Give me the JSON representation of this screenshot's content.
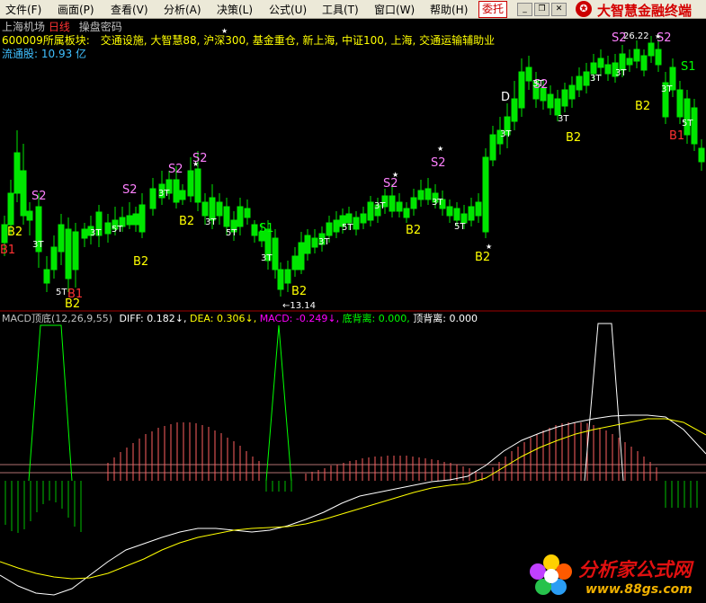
{
  "menu": {
    "items": [
      {
        "label": "文件(F)"
      },
      {
        "label": "画面(P)"
      },
      {
        "label": "查看(V)"
      },
      {
        "label": "分析(A)"
      },
      {
        "label": "决策(L)"
      },
      {
        "label": "公式(U)"
      },
      {
        "label": "工具(T)"
      },
      {
        "label": "窗口(W)"
      },
      {
        "label": "帮助(H)"
      }
    ],
    "entrust_label": "委托",
    "brand": "大智慧金融终端"
  },
  "stock": {
    "name": "上海机场",
    "period": "日线",
    "secret": "操盘密码",
    "sector_label": "600009所属板块:",
    "sectors": "交通设施, 大智慧88, 沪深300, 基金重仓, 新上海, 中证100, 上海, 交通运输辅助业",
    "float_label": "流通股:",
    "float_value": "10.93 亿"
  },
  "price_labels": {
    "high": "26.22",
    "low": "13.14"
  },
  "indicator": {
    "name": "MACD顶底",
    "params": "(12,26,9,55)",
    "diff_label": "DIFF:",
    "diff_value": "0.182",
    "dea_label": "DEA:",
    "dea_value": "0.306",
    "macd_label": "MACD:",
    "macd_value": "-0.249",
    "bottom_div_label": "底背离:",
    "bottom_div_value": "0.000",
    "top_div_label": "顶背离:",
    "top_div_value": "0.000"
  },
  "markers": {
    "b2": "B2",
    "s2": "S2",
    "t3": "3T",
    "t5": "5T",
    "s1": "S1",
    "b1": "B1",
    "d": "D"
  },
  "watermark": {
    "title": "分析家公式网",
    "url": "www.88gs.com"
  },
  "colors": {
    "up": "#ff3232",
    "down": "#00e600",
    "diff": "#ffffff",
    "dea": "#ffff00",
    "macd_label": "#ff00ff",
    "bottom_div": "#00ff00",
    "menu_bg": "#ece9d8"
  }
}
